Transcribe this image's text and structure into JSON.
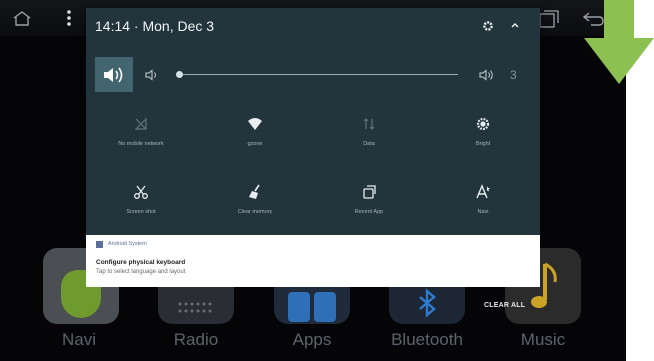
{
  "statusbar": {
    "icons": [
      "home-icon",
      "overflow-menu-icon",
      "recent-apps-icon",
      "back-icon"
    ]
  },
  "launcher": {
    "apps": [
      {
        "label": "Navi",
        "icon": "map-pin-icon"
      },
      {
        "label": "Radio",
        "icon": "radio-icon"
      },
      {
        "label": "Apps",
        "icon": "apps-grid-icon"
      },
      {
        "label": "Bluetooth",
        "icon": "bluetooth-icon"
      },
      {
        "label": "Music",
        "icon": "music-note-icon"
      }
    ],
    "clear_all": "CLEAR ALL"
  },
  "shade": {
    "time_date": "14:14 · Mon, Dec 3",
    "volume": {
      "level": "3",
      "fraction": 0.0
    },
    "tiles": [
      {
        "label": "No mobile network",
        "icon": "signal-off-icon"
      },
      {
        "label": "gzone",
        "icon": "wifi-icon"
      },
      {
        "label": "Data",
        "icon": "data-icon"
      },
      {
        "label": "Bright",
        "icon": "brightness-icon"
      },
      {
        "label": "Screen shot",
        "icon": "scissors-icon"
      },
      {
        "label": "Clear memory",
        "icon": "broom-icon"
      },
      {
        "label": "Recent App",
        "icon": "recent-app-icon"
      },
      {
        "label": "Navi",
        "icon": "navi-icon"
      }
    ]
  },
  "notification": {
    "app_name": "Android System",
    "title": "Configure physical keyboard",
    "text": "Tap to select language and layout"
  },
  "colors": {
    "shade_bg": "#22343c",
    "accent_arrow": "#8cc152",
    "volume_button": "#42656f"
  }
}
